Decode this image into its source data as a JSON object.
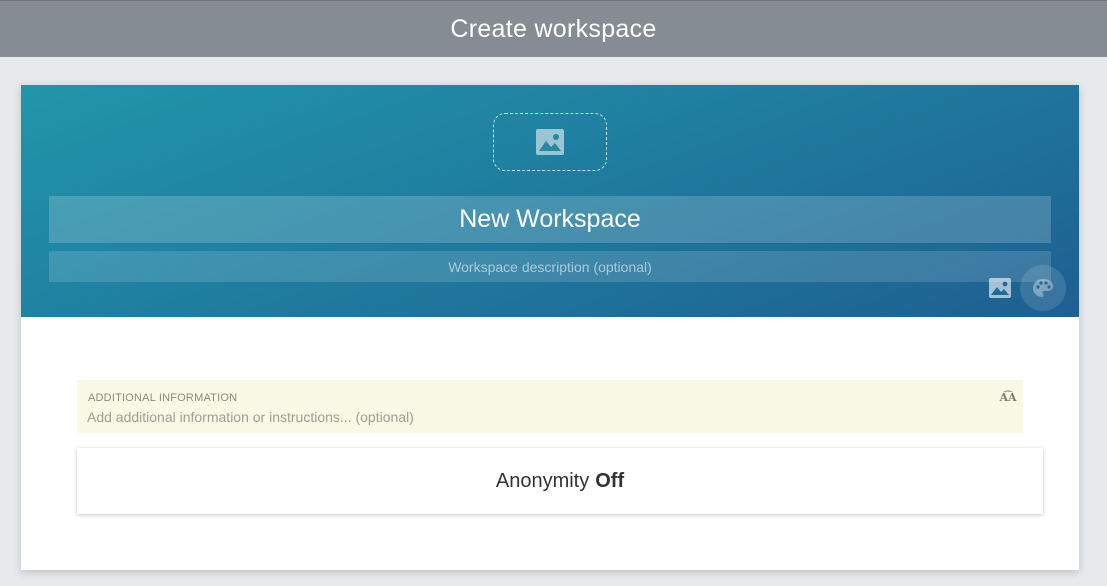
{
  "header": {
    "title": "Create workspace"
  },
  "banner": {
    "image_placeholder_icon": "image-icon",
    "title_value": "New Workspace",
    "description_placeholder": "Workspace description (optional)",
    "background_image_icon": "image-icon",
    "theme_icon": "palette-icon",
    "gradient_colors": [
      "#2196a9",
      "#1e5f91"
    ]
  },
  "additional_info": {
    "label": "ADDITIONAL INFORMATION",
    "placeholder": "Add additional information or instructions... (optional)",
    "format_icon": "text-format-icon",
    "format_glyph": "A͡A",
    "background": "#f9f9e6"
  },
  "anonymity": {
    "label": "Anonymity",
    "state": "Off"
  }
}
